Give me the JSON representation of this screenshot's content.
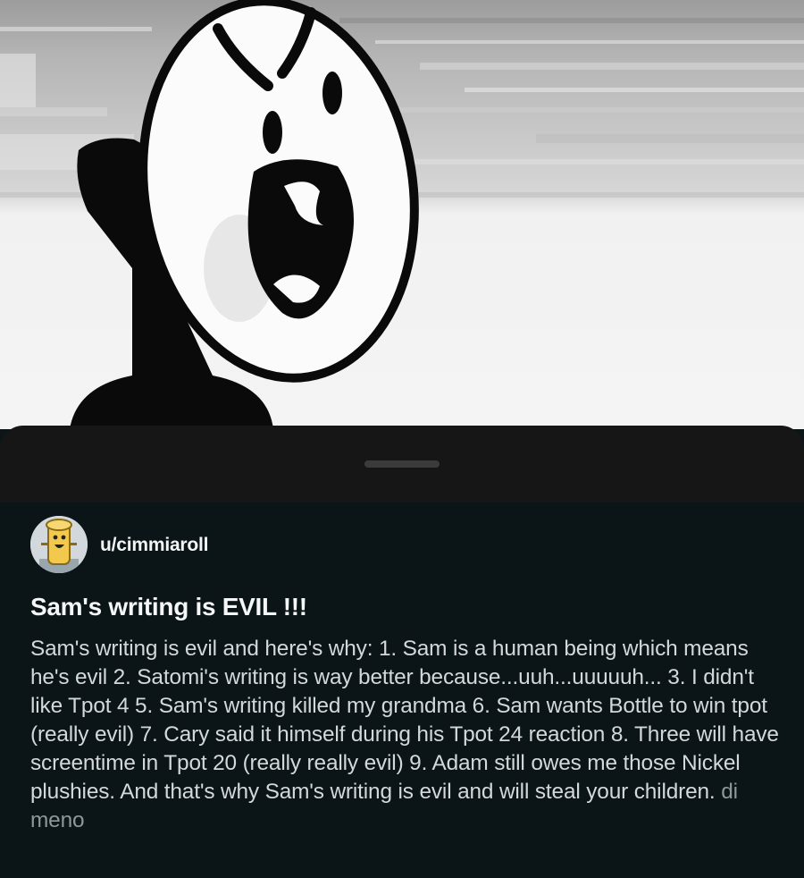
{
  "post": {
    "username": "u/cimmiaroll",
    "title": "Sam's writing is EVIL !!!",
    "body": "Sam's writing is evil and here's why: 1. Sam is a human being which means he's evil 2. Satomi's writing is way better because...uuh...uuuuuh... 3. I didn't like Tpot 4 5. Sam's writing killed my grandma 6. Sam wants Bottle to win tpot (really evil) 7. Cary said it himself during his Tpot 24 reaction 8. Three will have screentime in Tpot 20 (really really evil) 9. Adam still owes me those Nickel plushies. And that's why Sam's writing is evil and will steal your children.",
    "body_truncated": "di meno"
  },
  "icons": {
    "avatar": "toast-character-avatar",
    "drag_handle": "drag-handle"
  },
  "colors": {
    "sheet_background": "#0b1416",
    "handle_bar": "#161616",
    "text_primary": "#f4f6f7",
    "text_body": "#d3d8db",
    "text_faded": "#8e979b"
  }
}
